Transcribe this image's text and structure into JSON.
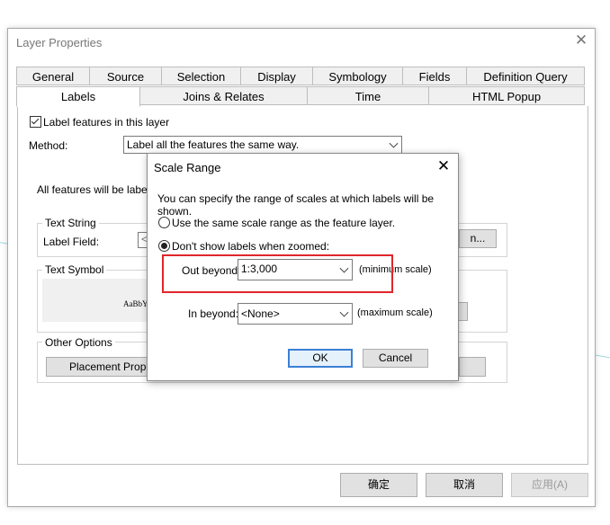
{
  "window": {
    "title": "Layer Properties",
    "close_glyph": "✕",
    "tabs_row1": [
      "General",
      "Source",
      "Selection",
      "Display",
      "Symbology",
      "Fields",
      "Definition Query"
    ],
    "tabs_row2": [
      "Labels",
      "Joins & Relates",
      "Time",
      "HTML Popup"
    ],
    "active_tab": "Labels"
  },
  "labels_page": {
    "label_features_checkbox": "Label features in this layer",
    "label_features_checked": true,
    "method_label": "Method:",
    "method_value": "Label all the features the same way.",
    "all_features_text": "All features will be labeled",
    "text_string_group": "Text String",
    "label_field_label": "Label Field:",
    "label_field_partial": "<",
    "expression_button_partial": "n...",
    "text_symbol_group": "Text Symbol",
    "symbol_preview": "AaBbY",
    "other_options_group": "Other Options",
    "placement_button": "Placement Propert"
  },
  "footer": {
    "ok": "确定",
    "cancel": "取消",
    "apply": "应用(A)"
  },
  "scale_range_dialog": {
    "title": "Scale Range",
    "close_glyph": "✕",
    "description": "You can specify the range of scales at which labels will be shown.",
    "option_same_scale": "Use the same scale range as the feature layer.",
    "option_dont_show": "Don't show labels when zoomed:",
    "selected_option": "dont_show",
    "out_beyond_label": "Out beyond:",
    "out_beyond_value": "1:3,000",
    "out_beyond_note": "(minimum scale)",
    "in_beyond_label": "In beyond:",
    "in_beyond_value": "<None>",
    "in_beyond_note": "(maximum scale)",
    "ok": "OK",
    "cancel": "Cancel"
  },
  "colors": {
    "highlight_border": "#e0262b",
    "primary_button_border": "#3c7fd6"
  }
}
